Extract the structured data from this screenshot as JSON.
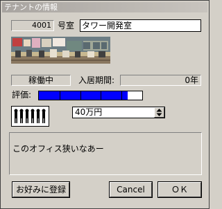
{
  "window": {
    "title": "テナントの情報"
  },
  "room": {
    "number": "4001",
    "number_suffix": "号室",
    "name_value": "タワー開発室"
  },
  "status": {
    "state": "稼働中",
    "tenure_label": "入居期間:",
    "tenure_value": "0年"
  },
  "rating": {
    "label": "評価:",
    "level_percent": 86,
    "bar_color": "#0000ff",
    "bar_divisions": 5
  },
  "rent": {
    "selected": "40万円",
    "icon": "people-icon"
  },
  "comment": {
    "text": "このオフィス狭いなあー"
  },
  "buttons": {
    "favorite": "お好みに登録",
    "cancel": "Cancel",
    "ok": "ＯＫ"
  }
}
